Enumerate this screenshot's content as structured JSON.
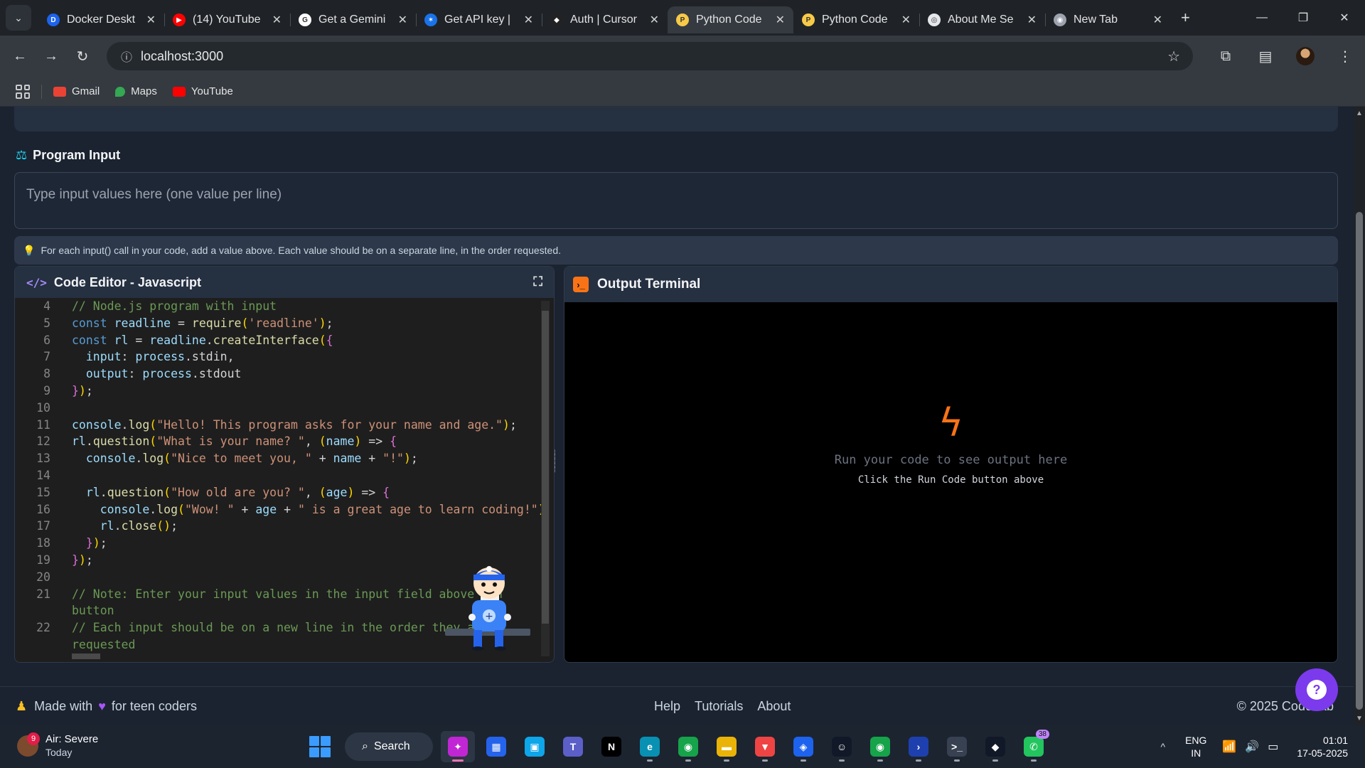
{
  "browser": {
    "tabs": [
      {
        "title": "Docker Deskt",
        "fav_color": "#1d63ed",
        "fav_glyph": "D",
        "icon": "docker-icon"
      },
      {
        "title": "(14) YouTube",
        "fav_color": "#ff0000",
        "fav_glyph": "▶",
        "icon": "youtube-icon"
      },
      {
        "title": "Get a Gemini",
        "fav_color": "#ffffff",
        "fav_glyph": "G",
        "icon": "google-icon"
      },
      {
        "title": "Get API key |",
        "fav_color": "#1a73e8",
        "fav_glyph": "✶",
        "icon": "ai-studio-icon"
      },
      {
        "title": "Auth | Cursor",
        "fav_color": "#222222",
        "fav_glyph": "◆",
        "icon": "cursor-icon"
      },
      {
        "title": "Python Code",
        "fav_color": "#f7c948",
        "fav_glyph": "P",
        "icon": "python-icon",
        "active": true
      },
      {
        "title": "Python Code",
        "fav_color": "#f7c948",
        "fav_glyph": "P",
        "icon": "python-icon"
      },
      {
        "title": "About Me Se",
        "fav_color": "#e5e7eb",
        "fav_glyph": "◎",
        "icon": "globe-icon"
      },
      {
        "title": "New Tab",
        "fav_color": "#9ca3af",
        "fav_glyph": "◉",
        "icon": "chrome-icon"
      }
    ],
    "url": "localhost:3000",
    "bookmarks": [
      {
        "label": "Gmail",
        "color": "#ea4335"
      },
      {
        "label": "Maps",
        "color": "#34a853"
      },
      {
        "label": "YouTube",
        "color": "#ff0000"
      }
    ]
  },
  "page": {
    "top_buttons": [
      {
        "color": "#4f46e5",
        "left_pct": 0.0
      },
      {
        "color": "#f97316"
      },
      {
        "color": "#06b6d4"
      },
      {
        "color": "#7c3aed"
      },
      {
        "color": "#6b7280"
      }
    ],
    "program_input": {
      "title": "Program Input",
      "placeholder": "Type input values here (one value per line)",
      "tip": "For each input() call in your code, add a value above. Each value should be on a separate line, in the order requested."
    },
    "editor": {
      "title": "Code Editor - Javascript",
      "line_numbers": [
        "4",
        "5",
        "6",
        "7",
        "8",
        "9",
        "10",
        "11",
        "12",
        "13",
        "14",
        "15",
        "16",
        "17",
        "18",
        "19",
        "20",
        "21",
        "",
        "22",
        ""
      ],
      "lines": [
        "// Node.js program with input",
        "const readline = require('readline');",
        "const rl = readline.createInterface({",
        "  input: process.stdin,",
        "  output: process.stdout",
        "});",
        "",
        "console.log(\"Hello! This program asks for your name and age.\");",
        "rl.question(\"What is your name? \", (name) => {",
        "  console.log(\"Nice to meet you, \" + name + \"!\");",
        "",
        "  rl.question(\"How old are you? \", (age) => {",
        "    console.log(\"Wow! \" + age + \" is a great age to learn coding!\");",
        "    rl.close();",
        "  });",
        "});",
        "",
        "// Note: Enter your input values in the input field above Run",
        "button",
        "// Each input should be on a new line in the order they are",
        "requested"
      ]
    },
    "terminal": {
      "title": "Output Terminal",
      "empty_message": "Run your code to see output here",
      "empty_hint": "Click the Run Code button above"
    },
    "footer": {
      "made_with_prefix": "Made with",
      "made_with_suffix": "for teen coders",
      "links": [
        "Help",
        "Tutorials",
        "About"
      ],
      "copyright": "© 2025 CodeLab"
    }
  },
  "taskbar": {
    "weather_title": "Air: Severe",
    "weather_sub": "Today",
    "weather_badge": "9",
    "search_label": "Search",
    "apps": [
      {
        "name": "copilot-icon",
        "color": "#c026d3",
        "glyph": "✦",
        "active": true
      },
      {
        "name": "store-icon",
        "color": "#2563eb",
        "glyph": "▦"
      },
      {
        "name": "photos-icon",
        "color": "#0ea5e9",
        "glyph": "▣"
      },
      {
        "name": "teams-icon",
        "color": "#5b5fc7",
        "glyph": "T"
      },
      {
        "name": "netflix-icon",
        "color": "#000000",
        "glyph": "N"
      },
      {
        "name": "edge-icon",
        "color": "#0891b2",
        "glyph": "e"
      },
      {
        "name": "chrome-icon",
        "color": "#16a34a",
        "glyph": "◉"
      },
      {
        "name": "file-explorer-icon",
        "color": "#eab308",
        "glyph": "▬"
      },
      {
        "name": "brave-icon",
        "color": "#ef4444",
        "glyph": "▼"
      },
      {
        "name": "docker-icon",
        "color": "#1d63ed",
        "glyph": "◈"
      },
      {
        "name": "linux-icon",
        "color": "#111827",
        "glyph": "☺"
      },
      {
        "name": "chrome-profile-icon",
        "color": "#16a34a",
        "glyph": "◉"
      },
      {
        "name": "powershell-icon",
        "color": "#1e40af",
        "glyph": "›"
      },
      {
        "name": "terminal-icon",
        "color": "#374151",
        "glyph": ">_"
      },
      {
        "name": "cursor-icon",
        "color": "#111827",
        "glyph": "◆"
      },
      {
        "name": "whatsapp-icon",
        "color": "#22c55e",
        "glyph": "✆",
        "badge": "38"
      }
    ],
    "lang_1": "ENG",
    "lang_2": "IN",
    "time": "01:01",
    "date": "17-05-2025"
  }
}
